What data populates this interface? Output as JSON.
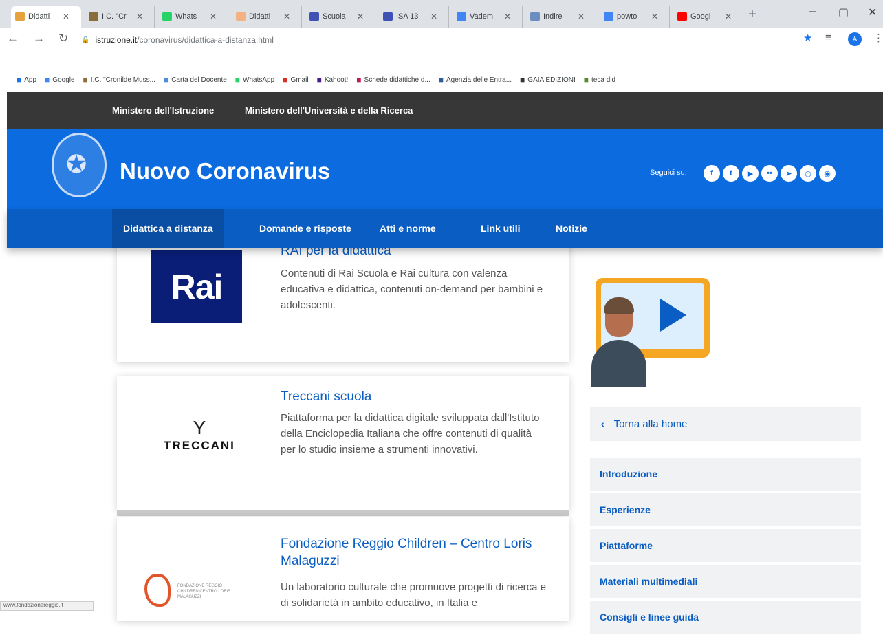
{
  "browser": {
    "tabs": [
      {
        "label": "Didatti",
        "icon": "site-dots-icon",
        "color": "#e6a23c",
        "active": true
      },
      {
        "label": "I.C. \"Cr",
        "icon": "school-icon",
        "color": "#8a6d3b"
      },
      {
        "label": "Whats",
        "icon": "whatsapp-icon",
        "color": "#25d366"
      },
      {
        "label": "Didatti",
        "icon": "site-icon",
        "color": "#f4b183"
      },
      {
        "label": "Scuola",
        "icon": "forms-icon",
        "color": "#3f51b5"
      },
      {
        "label": "ISA 13",
        "icon": "forms-icon",
        "color": "#3f51b5"
      },
      {
        "label": "Vadem",
        "icon": "docs-icon",
        "color": "#4285f4"
      },
      {
        "label": "Indire",
        "icon": "indire-icon",
        "color": "#6a8ebf"
      },
      {
        "label": "powto",
        "icon": "google-icon",
        "color": "#4285f4"
      },
      {
        "label": "Googl",
        "icon": "youtube-icon",
        "color": "#ff0000"
      }
    ],
    "url_host": "istruzione.it",
    "url_path": "/coronavirus/didattica-a-distanza.html",
    "profile_initial": "A",
    "bookmarks": [
      {
        "label": "App",
        "icon": "apps-grid-icon",
        "color": "#1a73e8"
      },
      {
        "label": "Google",
        "icon": "google-icon",
        "color": "#4285f4"
      },
      {
        "label": "I.C. \"Cronilde Muss...",
        "icon": "school-icon",
        "color": "#8a6d3b"
      },
      {
        "label": "Carta del Docente",
        "icon": "doc-icon",
        "color": "#4a90d9"
      },
      {
        "label": "WhatsApp",
        "icon": "whatsapp-icon",
        "color": "#25d366"
      },
      {
        "label": "Gmail",
        "icon": "gmail-icon",
        "color": "#d93025"
      },
      {
        "label": "Kahoot!",
        "icon": "kahoot-icon",
        "color": "#46178f"
      },
      {
        "label": "Schede didattiche d...",
        "icon": "m-icon",
        "color": "#c2185b"
      },
      {
        "label": "Agenzia delle Entra...",
        "icon": "agenzia-icon",
        "color": "#2e5c9a"
      },
      {
        "label": "GAIA EDIZIONI",
        "icon": "globe-icon",
        "color": "#333333"
      },
      {
        "label": "teca did",
        "icon": "leaf-icon",
        "color": "#558b2f"
      }
    ]
  },
  "site": {
    "slim_links": [
      "Ministero dell'Istruzione",
      "Ministero dell'Università e della Ricerca"
    ],
    "title": "Nuovo Coronavirus",
    "follow_label": "Seguici su:",
    "social_icons": [
      "facebook-icon",
      "twitter-icon",
      "youtube-icon",
      "flickr-icon",
      "telegram-icon",
      "instagram-icon",
      "rss-icon"
    ],
    "nav": [
      "Didattica a distanza",
      "Domande e risposte",
      "Atti e norme",
      "Link utili",
      "Notizie"
    ],
    "accent": "#0b6bdf"
  },
  "cards": [
    {
      "title": "RAI per la didattica",
      "logo": "Rai",
      "description": "Contenuti di Rai Scuola e Rai cultura con valenza educativa e didattica, contenuti on-demand per bambini e adolescenti."
    },
    {
      "title": "Treccani scuola",
      "logo_symbol": "Υ",
      "logo": "TRECCANI",
      "description": "Piattaforma per la didattica digitale sviluppata dall'Istituto della Enciclopedia Italiana che offre contenuti di qualità per lo studio insieme a strumenti innovativi."
    },
    {
      "title": "Fondazione Reggio Children – Centro Loris Malaguzzi",
      "logo": "FONDAZIONE REGGIO CHILDREN CENTRO LORIS MALAGUZZI",
      "description": "Un laboratorio culturale che promuove progetti di ricerca e di solidarietà in ambito educativo, in Italia e"
    }
  ],
  "sidebar": {
    "back_label": "Torna alla home",
    "items": [
      "Introduzione",
      "Esperienze",
      "Piattaforme",
      "Materiali multimediali",
      "Consigli e linee guida"
    ]
  },
  "status_url": "www.fondazionereggio.it"
}
